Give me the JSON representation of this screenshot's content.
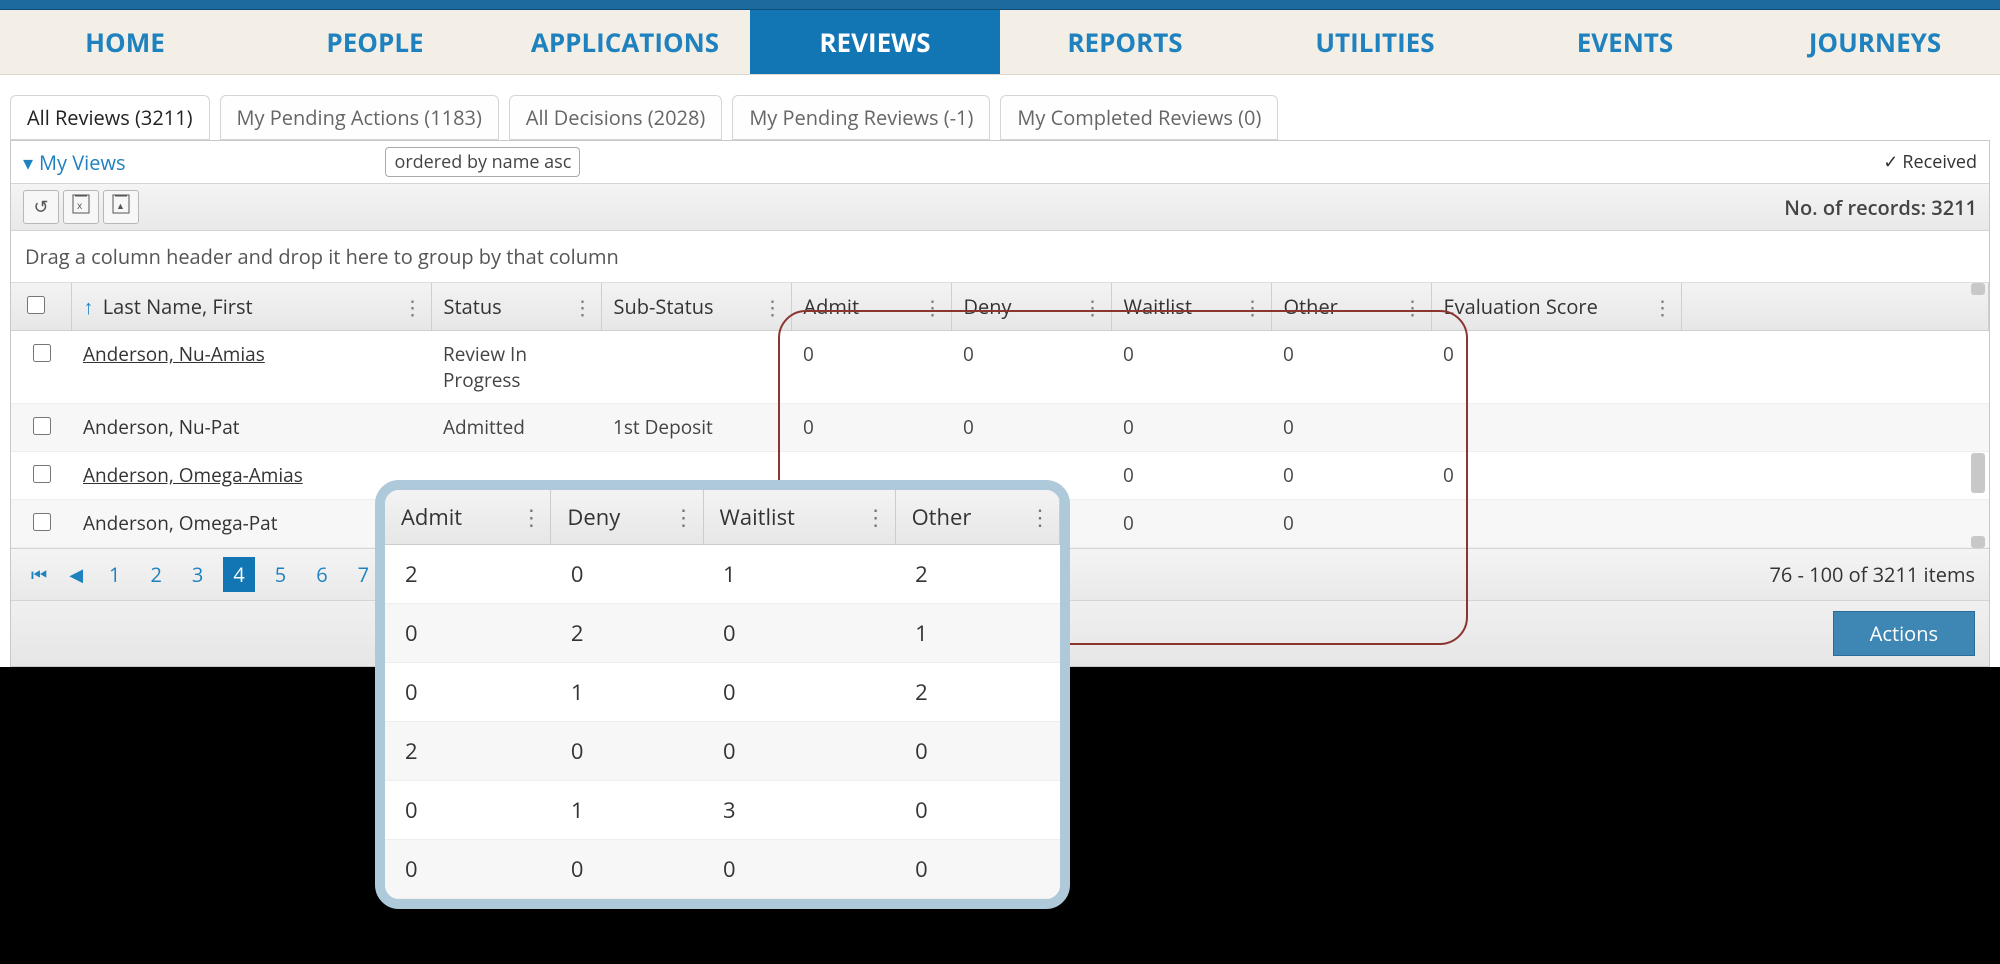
{
  "nav": {
    "items": [
      {
        "label": "HOME"
      },
      {
        "label": "PEOPLE"
      },
      {
        "label": "APPLICATIONS"
      },
      {
        "label": "REVIEWS",
        "active": true
      },
      {
        "label": "REPORTS"
      },
      {
        "label": "UTILITIES"
      },
      {
        "label": "EVENTS"
      },
      {
        "label": "JOURNEYS"
      }
    ]
  },
  "tabs": [
    {
      "label": "All Reviews (3211)",
      "active": true
    },
    {
      "label": "My Pending Actions (1183)"
    },
    {
      "label": "All Decisions (2028)"
    },
    {
      "label": "My Pending Reviews (-1)"
    },
    {
      "label": "My Completed Reviews (0)"
    }
  ],
  "myviews": "My Views",
  "orderbox": "ordered by name asc",
  "received": "Received",
  "records_label": "No. of records: 3211",
  "drag_hint": "Drag a column header and drop it here to group by that column",
  "columns": {
    "name": "Last Name, First",
    "status": "Status",
    "substatus": "Sub-Status",
    "admit": "Admit",
    "deny": "Deny",
    "waitlist": "Waitlist",
    "other": "Other",
    "score": "Evaluation Score"
  },
  "rows": [
    {
      "name": "Anderson, Nu-Amias",
      "link": true,
      "status": "Review In Progress",
      "substatus": "",
      "admit": "0",
      "deny": "0",
      "waitlist": "0",
      "other": "0",
      "score": "0"
    },
    {
      "name": "Anderson, Nu-Pat",
      "link": false,
      "status": "Admitted",
      "substatus": "1st Deposit",
      "admit": "0",
      "deny": "0",
      "waitlist": "0",
      "other": "0",
      "score": ""
    },
    {
      "name": "Anderson, Omega-Amias",
      "link": true,
      "status": "",
      "substatus": "",
      "admit": "",
      "deny": "",
      "waitlist": "0",
      "other": "0",
      "score": "0"
    },
    {
      "name": "Anderson, Omega-Pat",
      "link": false,
      "status": "",
      "substatus": "",
      "admit": "",
      "deny": "",
      "waitlist": "0",
      "other": "0",
      "score": ""
    }
  ],
  "pager": {
    "pages": [
      "1",
      "2",
      "3",
      "4",
      "5",
      "6",
      "7"
    ],
    "active": "4",
    "summary": "76 - 100 of 3211 items"
  },
  "actions_label": "Actions",
  "overlay": {
    "columns": [
      "Admit",
      "Deny",
      "Waitlist",
      "Other"
    ],
    "rows": [
      [
        "2",
        "0",
        "1",
        "2"
      ],
      [
        "0",
        "2",
        "0",
        "1"
      ],
      [
        "0",
        "1",
        "0",
        "2"
      ],
      [
        "2",
        "0",
        "0",
        "0"
      ],
      [
        "0",
        "1",
        "3",
        "0"
      ],
      [
        "0",
        "0",
        "0",
        "0"
      ]
    ]
  }
}
